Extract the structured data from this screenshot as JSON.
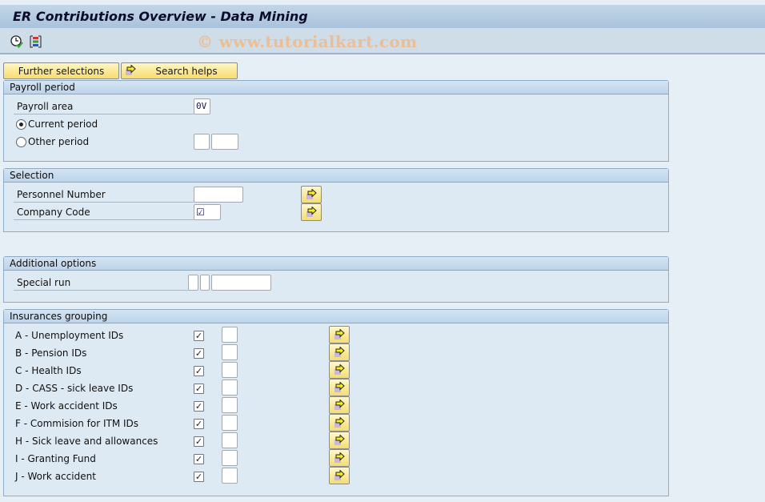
{
  "window": {
    "title": "ER Contributions Overview - Data Mining",
    "watermark": "© www.tutorialkart.com"
  },
  "toolbar": {
    "icons": [
      "execute-clock-icon",
      "selection-options-icon"
    ]
  },
  "buttons": {
    "further_selections": "Further selections",
    "search_helps": "Search helps"
  },
  "payroll_period": {
    "title": "Payroll period",
    "payroll_area_label": "Payroll area",
    "payroll_area_value": "0V",
    "current_period_label": "Current period",
    "current_period_selected": true,
    "other_period_label": "Other period",
    "other_period_selected": false,
    "other_period_value1": "",
    "other_period_value2": ""
  },
  "selection": {
    "title": "Selection",
    "personnel_number_label": "Personnel Number",
    "personnel_number_value": "",
    "company_code_label": "Company Code",
    "company_code_value": "☑"
  },
  "additional_options": {
    "title": "Additional options",
    "special_run_label": "Special run",
    "special_run_value1": "",
    "special_run_value2": "",
    "special_run_value3": ""
  },
  "insurances_grouping": {
    "title": "Insurances grouping",
    "items": [
      {
        "label": "A - Unemployment IDs",
        "checked": true,
        "value": ""
      },
      {
        "label": "B - Pension IDs",
        "checked": true,
        "value": ""
      },
      {
        "label": "C - Health IDs",
        "checked": true,
        "value": ""
      },
      {
        "label": "D - CASS - sick leave IDs",
        "checked": true,
        "value": ""
      },
      {
        "label": "E - Work accident IDs",
        "checked": true,
        "value": ""
      },
      {
        "label": "F - Commision for ITM IDs",
        "checked": true,
        "value": ""
      },
      {
        "label": "H - Sick leave and allowances",
        "checked": true,
        "value": ""
      },
      {
        "label": "I - Granting Fund",
        "checked": true,
        "value": ""
      },
      {
        "label": "J - Work accident",
        "checked": true,
        "value": ""
      }
    ]
  }
}
